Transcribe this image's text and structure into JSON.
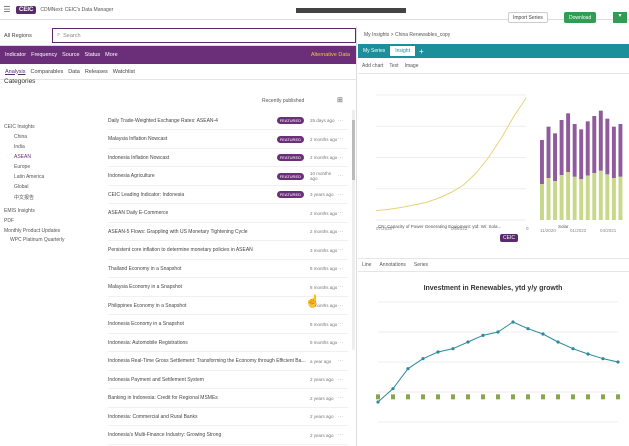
{
  "app": {
    "logo": "CEIC",
    "title": "CDMNext: CEIC's Data Manager",
    "import_label": "Import Series",
    "download_label": "Download"
  },
  "search": {
    "regions": "All Regions",
    "placeholder": "Search"
  },
  "filters": {
    "items": [
      "Indicator",
      "Frequency",
      "Source",
      "Status",
      "More"
    ],
    "alt_data": "Alternative Data"
  },
  "tabs": {
    "items": [
      "Analysis",
      "Comparables",
      "Data",
      "Releases",
      "Watchlist"
    ],
    "active": 0
  },
  "categories": {
    "title": "Categories",
    "items": [
      "CEIC Insights",
      "China",
      "India",
      "ASEAN",
      "Europe",
      "Latin America",
      "Global",
      "中文报告",
      "EMIS Insights",
      "PDF",
      "Monthly Product Updates",
      "WPC Platinum Quarterly"
    ]
  },
  "list": {
    "sort_label": "Recently published",
    "rows": [
      {
        "title": "Daily Trade-Weighted Exchange Rates: ASEAN-4",
        "badge": "FEATURED",
        "time": "25 days ago"
      },
      {
        "title": "Malaysia Inflation Nowcast",
        "badge": "FEATURED",
        "time": "2 months ago"
      },
      {
        "title": "Indonesia Inflation Nowcast",
        "badge": "FEATURED",
        "time": "2 months ago"
      },
      {
        "title": "Indonesia Agriculture",
        "badge": "FEATURED",
        "time": "10 months ago"
      },
      {
        "title": "CEIC Leading Indicator: Indonesia",
        "badge": "FEATURED",
        "time": "3 years ago"
      },
      {
        "title": "ASEAN Daily E-Commerce",
        "badge": "",
        "time": "2 months ago"
      },
      {
        "title": "ASEAN-5 Flows: Grappling with US Monetary Tightening Cycle",
        "badge": "",
        "time": "2 months ago"
      },
      {
        "title": "Persistent core inflation to determine monetary policies in ASEAN",
        "badge": "",
        "time": "3 months ago"
      },
      {
        "title": "Thailand Economy in a Snapshot",
        "badge": "",
        "time": "8 months ago"
      },
      {
        "title": "Malaysia Economy in a Snapshot",
        "badge": "",
        "time": "8 months ago"
      },
      {
        "title": "Philippines Economy in a Snapshot",
        "badge": "",
        "time": "8 months ago"
      },
      {
        "title": "Indonesia Economy in a Snapshot",
        "badge": "",
        "time": "8 months ago"
      },
      {
        "title": "Indonesia: Automobile Registrations",
        "badge": "",
        "time": "9 months ago"
      },
      {
        "title": "Indonesia Real-Time Gross Settlement: Transforming the Economy through Efficient Ba...",
        "badge": "",
        "time": "a year ago"
      },
      {
        "title": "Indonesia Payment and Settlement System",
        "badge": "",
        "time": "2 years ago"
      },
      {
        "title": "Banking in Indonesia: Credit for Regional MSMEs",
        "badge": "",
        "time": "2 years ago"
      },
      {
        "title": "Indonesia: Commercial and Rural Banks",
        "badge": "",
        "time": "2 years ago"
      },
      {
        "title": "Indonesia's Multi-Finance Industry: Growing Strong",
        "badge": "",
        "time": "2 years ago"
      }
    ]
  },
  "right": {
    "crumb": "My Insights > China Renewables_copy",
    "tabs": [
      "My Series",
      "Insight"
    ],
    "toolbar": [
      "Add chart",
      "Text",
      "Image"
    ],
    "toolbar2": [
      "Line",
      "Annotations",
      "Series"
    ],
    "chart1_legend": "CN: Capacity of Power Generating Equipment: ytd: Wi: Sola...",
    "chart2_legend": "Solar",
    "chart3_title": "Investment in Renewables, ytd y/y growth",
    "accent_purple": "#6b2f7a",
    "accent_teal": "#1b8f9a"
  },
  "chart_data": [
    {
      "type": "line",
      "title": "",
      "x": [
        "07/2020",
        "04/2022",
        "01/2023"
      ],
      "series": [
        {
          "name": "CN: Capacity of Power Generating Equipment: ytd: Wi: Sola...",
          "values": [
            30,
            34,
            40,
            48,
            56,
            70,
            88,
            112,
            150,
            200,
            260,
            330,
            390
          ]
        }
      ],
      "ylim": [
        0,
        400
      ],
      "grid": true
    },
    {
      "type": "bar",
      "title": "",
      "x": [
        "11/2020",
        "01/2022",
        "04/2021"
      ],
      "series": [
        {
          "name": "Solar",
          "values": [
            60,
            70,
            65,
            75,
            80,
            72,
            68,
            74,
            78,
            82,
            76,
            70,
            72
          ]
        }
      ]
    },
    {
      "type": "line",
      "title": "Investment in Renewables, ytd y/y growth",
      "series": [
        {
          "name": "",
          "values": [
            -10,
            10,
            40,
            55,
            65,
            70,
            80,
            90,
            95,
            110,
            100,
            92,
            80,
            70,
            62,
            55,
            50
          ]
        },
        {
          "name": "",
          "values": [
            0,
            0,
            0,
            0,
            0,
            0,
            0,
            0,
            0,
            0,
            0,
            0,
            0,
            0,
            0,
            0,
            0
          ]
        }
      ],
      "ylim": [
        -40,
        140
      ]
    }
  ]
}
